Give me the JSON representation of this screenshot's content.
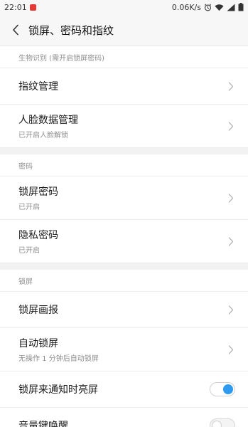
{
  "status_bar": {
    "time": "22:01",
    "network_speed": "0.06K/s",
    "icons": [
      "notification-icon",
      "alarm-icon",
      "wifi-icon",
      "signal-icon",
      "battery-icon"
    ]
  },
  "app_bar": {
    "title": "锁屏、密码和指纹"
  },
  "sections": {
    "biometrics": {
      "header": "生物识别 (需开启锁屏密码)",
      "fingerprint": {
        "label": "指纹管理"
      },
      "face": {
        "label": "人脸数据管理",
        "sub": "已开启人脸解锁"
      }
    },
    "password": {
      "header": "密码",
      "lock_password": {
        "label": "锁屏密码",
        "sub": "已开启"
      },
      "privacy_password": {
        "label": "隐私密码",
        "sub": "已开启"
      }
    },
    "lockscreen": {
      "header": "锁屏",
      "wallpaper": {
        "label": "锁屏画报"
      },
      "auto_lock": {
        "label": "自动锁屏",
        "sub": "无操作 1 分钟后自动锁屏"
      },
      "wake_on_notification": {
        "label": "锁屏来通知时亮屏",
        "toggle": "on"
      },
      "volume_wake": {
        "label": "音量键唤醒",
        "toggle": "off"
      }
    }
  },
  "colors": {
    "accent": "#2e9bf0",
    "secondary_text": "#8e8e8e",
    "section_gap": "#f2f2f2"
  }
}
